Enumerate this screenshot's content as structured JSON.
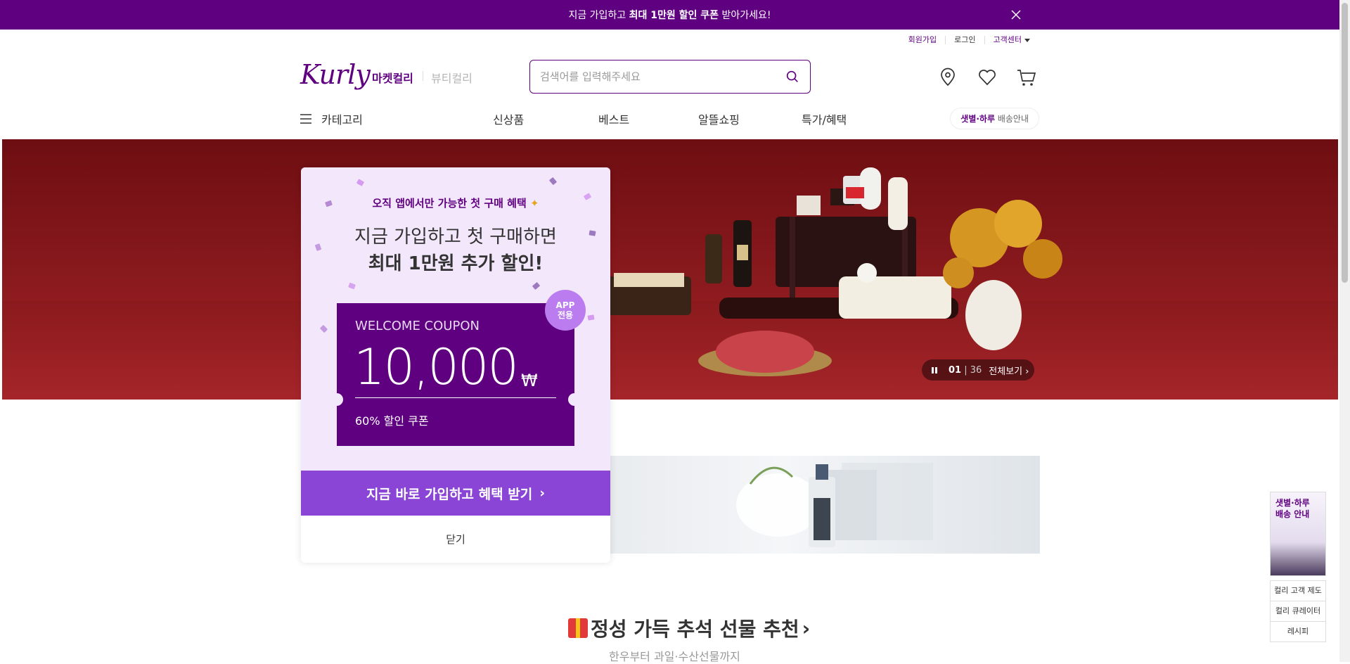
{
  "topbar": {
    "pre": "지금 가입하고 ",
    "bold": "최대 1만원 할인 쿠폰",
    "post": " 받아가세요!"
  },
  "util": {
    "signup": "회원가입",
    "login": "로그인",
    "cs": "고객센터"
  },
  "brand": {
    "logo": "Kurly",
    "market": "마켓컬리",
    "beauty": "뷰티컬리"
  },
  "search": {
    "placeholder": "검색어를 입력해주세요"
  },
  "gnb": {
    "category": "카테고리",
    "new": "신상품",
    "best": "베스트",
    "saving": "알뜰쇼핑",
    "special": "특가/혜택",
    "delivery_bold": "샛별·하루",
    "delivery_rest": " 배송안내"
  },
  "hero": {
    "current": "01",
    "total": "36",
    "view_all": "전체보기"
  },
  "section": {
    "title": "정성 가득 추석 선물 추천",
    "subtitle": "한우부터 과일·수산선물까지"
  },
  "side": {
    "banner": "샛별·하루\n배송 안내",
    "items": [
      "컬리 고객 제도",
      "컬리 큐레이터",
      "레시피"
    ]
  },
  "popup": {
    "badge": "오직 앱에서만 가능한 첫 구매 혜택",
    "headline1": "지금 가입하고 첫 구매하면",
    "headline2": "최대 1만원 추가 할인!",
    "coupon_title": "WELCOME COUPON",
    "amount": "10,000",
    "currency": "₩",
    "coupon_sub": "60% 할인 쿠폰",
    "app_badge_1": "APP",
    "app_badge_2": "전용",
    "cta": "지금 바로 가입하고 혜택 받기",
    "close": "닫기"
  },
  "colors": {
    "brand": "#5f0080",
    "cta": "#8a45d6",
    "popup_bg": "#f3e7fb",
    "hero": "#8a1a1e"
  }
}
